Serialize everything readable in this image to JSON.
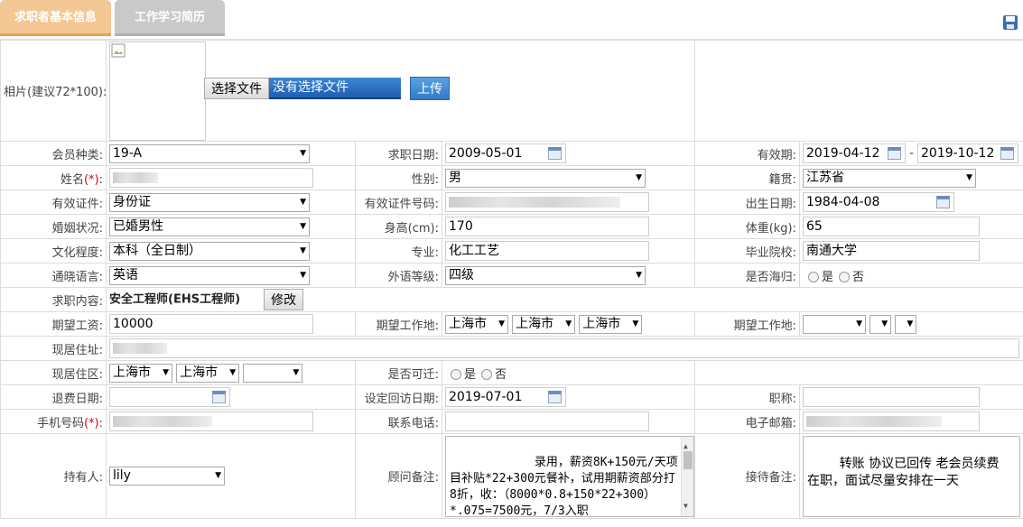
{
  "tabs": {
    "basic": "求职者基本信息",
    "history": "工作学习简历"
  },
  "photo": {
    "label": "相片(建议72*100):",
    "choose_btn": "选择文件",
    "no_file": "没有选择文件",
    "upload_btn": "上传"
  },
  "labels": {
    "member_type": "会员种类:",
    "job_date": "求职日期:",
    "valid_period": "有效期:",
    "name": "姓名",
    "name_req": "(*)",
    "name_colon": ":",
    "gender": "性别:",
    "origin": "籍贯:",
    "id_type": "有效证件:",
    "id_no": "有效证件号码:",
    "birth": "出生日期:",
    "marital": "婚姻状况:",
    "height": "身高(cm):",
    "weight": "体重(kg):",
    "education": "文化程度:",
    "major": "专业:",
    "school": "毕业院校:",
    "language": "通晓语言:",
    "lang_level": "外语等级:",
    "overseas": "是否海归:",
    "job_content": "求职内容:",
    "salary": "期望工资:",
    "exp_location": "期望工作地:",
    "exp_location2": "期望工作地:",
    "address": "现居住址:",
    "area": "现居住区:",
    "relocate": "是否可迁:",
    "refund_date": "退费日期:",
    "visit_date": "设定回访日期:",
    "title": "职称:",
    "mobile": "手机号码",
    "mobile_req": "(*)",
    "mobile_colon": ":",
    "phone": "联系电话:",
    "email": "电子邮箱:",
    "holder": "持有人:",
    "consultant_note": "顾问备注:",
    "reception_note": "接待备注:"
  },
  "values": {
    "member_type": "19-A",
    "job_date": "2009-05-01",
    "valid_from": "2019-04-12",
    "valid_sep": "-",
    "valid_to": "2019-10-12",
    "gender": "男",
    "origin": "江苏省",
    "id_type": "身份证",
    "birth": "1984-04-08",
    "marital": "已婚男性",
    "height": "170",
    "weight": "65",
    "education": "本科（全日制）",
    "major": "化工工艺",
    "school": "南通大学",
    "language": "英语",
    "lang_level": "四级",
    "yes": "是",
    "no": "否",
    "job_content": "安全工程师(EHS工程师)",
    "modify_btn": "修改",
    "salary": "10000",
    "loc1": "上海市",
    "loc2": "上海市",
    "loc3": "上海市",
    "area1": "上海市",
    "area2": "上海市",
    "visit_date": "2019-07-01",
    "holder": "lily",
    "consultant_note": "    录用，薪资8K+150元/天项目补贴*22+300元餐补，试用期薪资部分打8折，收：（8000*0.8+150*22+300）*.075=7500元，7/3入职",
    "reception_note": "转账 协议已回传 老会员续费\n在职，面试尽量安排在一天"
  }
}
